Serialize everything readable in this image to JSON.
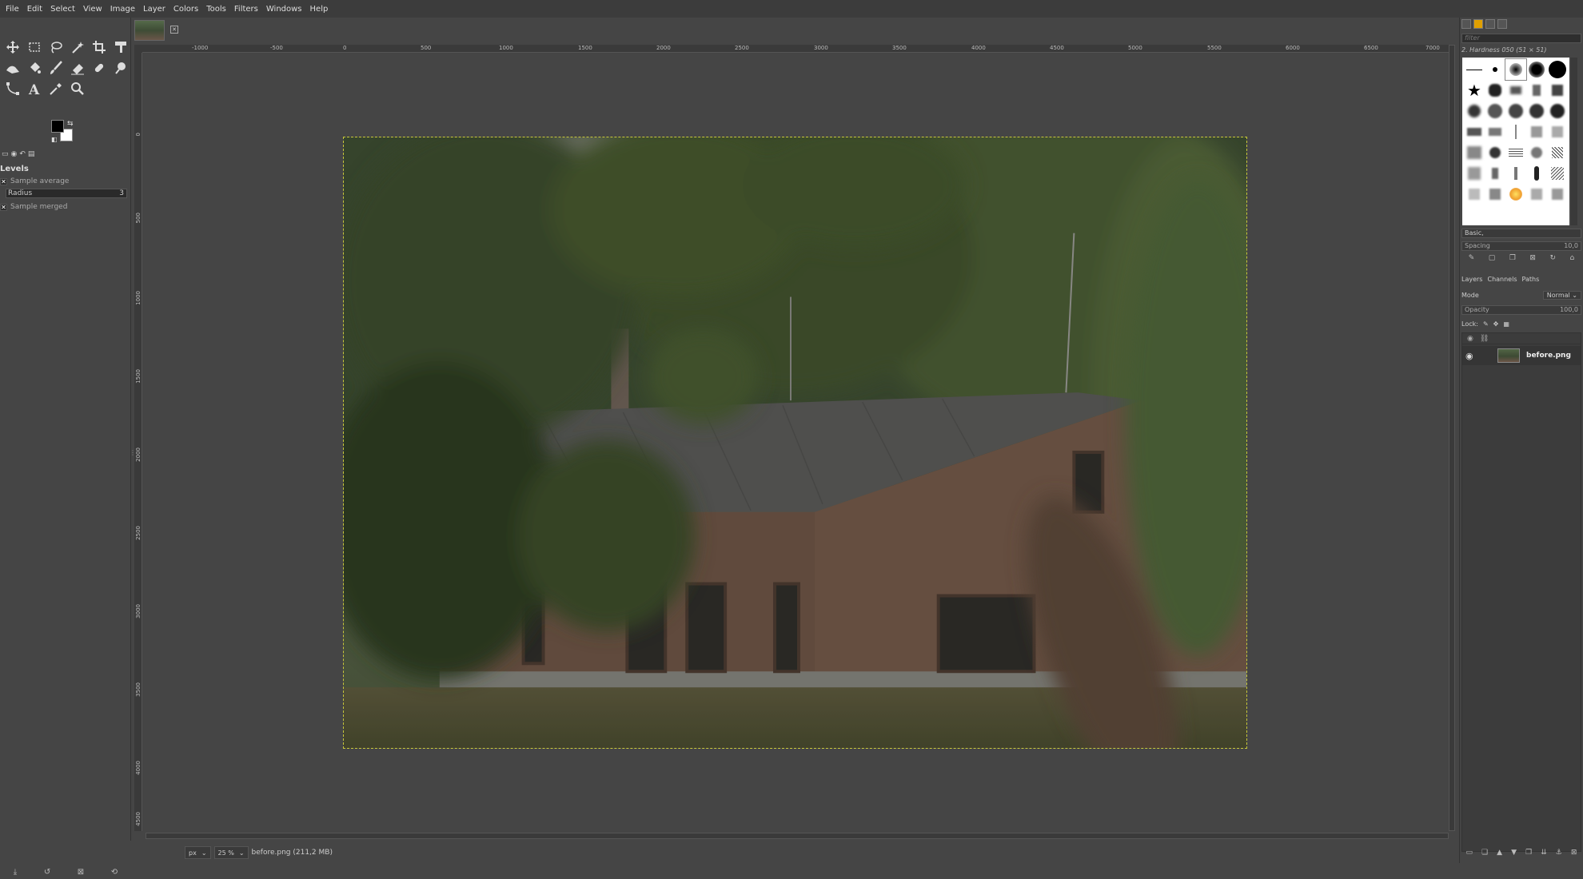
{
  "menu": [
    "File",
    "Edit",
    "Select",
    "View",
    "Image",
    "Layer",
    "Colors",
    "Tools",
    "Filters",
    "Windows",
    "Help"
  ],
  "toolbox": {
    "tools": [
      "move-tool",
      "rect-select-tool",
      "free-select-tool",
      "fuzzy-select-tool",
      "crop-tool",
      "transform-tool",
      "warp-tool",
      "bucket-fill-tool",
      "paintbrush-tool",
      "eraser-tool",
      "heal-tool",
      "smudge-tool",
      "paths-tool",
      "text-tool",
      "color-picker-tool",
      "zoom-tool"
    ],
    "fg_color": "#000000",
    "bg_color": "#ffffff"
  },
  "tool_options": {
    "title": "Levels",
    "sample_average": "Sample average",
    "radius_label": "Radius",
    "radius_value": "3",
    "sample_merged": "Sample merged"
  },
  "ruler": {
    "top_labels": [
      "-1000",
      "-500",
      "0",
      "500",
      "1000",
      "1500",
      "2000",
      "2500",
      "3000",
      "3500",
      "4000",
      "4500",
      "5000",
      "5500",
      "6000",
      "6500",
      "7000"
    ],
    "left_labels": [
      "0",
      "500",
      "1000",
      "1500",
      "2000",
      "2500",
      "3000",
      "3500",
      "4000",
      "4500"
    ]
  },
  "status": {
    "unit": "px",
    "zoom": "25 %",
    "file_info": "before.png (211,2 MB)"
  },
  "brushes": {
    "filter_placeholder": "filter",
    "current_brush": "2. Hardness 050 (51 × 51)",
    "preset": "Basic,",
    "spacing_label": "Spacing",
    "spacing_value": "10,0"
  },
  "layers_dock": {
    "tabs": [
      "Layers",
      "Channels",
      "Paths"
    ],
    "mode_label": "Mode",
    "mode_value": "Normal",
    "opacity_label": "Opacity",
    "opacity_value": "100,0",
    "lock_label": "Lock:",
    "layers": [
      {
        "name": "before.png",
        "visible": true
      }
    ]
  },
  "colors": {
    "selection_border": "#c8c83a",
    "ui_background": "#454545"
  }
}
